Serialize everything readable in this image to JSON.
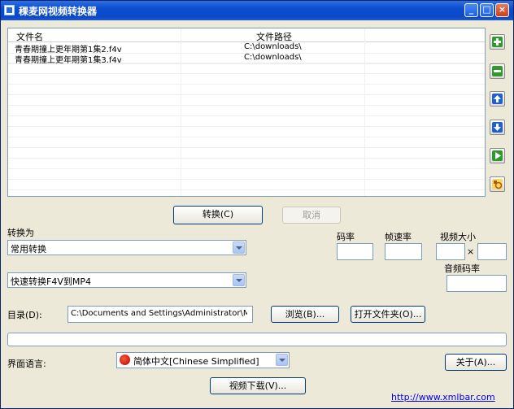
{
  "window": {
    "title": "稞麦网视频转换器"
  },
  "file_list": {
    "columns": [
      "文件名",
      "文件路径"
    ],
    "rows": [
      {
        "name": "青春期撞上更年期第1集2.f4v",
        "path": "C:\\downloads\\"
      },
      {
        "name": "青春期撞上更年期第1集3.f4v",
        "path": "C:\\downloads\\"
      }
    ]
  },
  "side_icons": [
    "add-icon",
    "remove-icon",
    "move-up-icon",
    "move-down-icon",
    "play-icon",
    "settings-icon"
  ],
  "actions": {
    "convert": "转换(C)",
    "cancel": "取消"
  },
  "convert_to": {
    "label": "转换为",
    "category": "常用转换",
    "preset": "快速转换F4V到MP4"
  },
  "params": {
    "bitrate_label": "码率",
    "framerate_label": "帧速率",
    "video_size_label": "视频大小",
    "size_sep": "×",
    "audio_bitrate_label": "音频码率"
  },
  "output": {
    "dir_label": "目录(D):",
    "dir_value": "C:\\Documents and Settings\\Administrator\\My Documents",
    "browse": "浏览(B)...",
    "open_folder": "打开文件夹(O)..."
  },
  "language": {
    "label": "界面语言:",
    "value": "简体中文[Chinese Simplified]"
  },
  "about": "关于(A)...",
  "video_download": "视频下载(V)...",
  "footer_link": "http://www.xmlbar.com",
  "colors": {
    "titlebar": "#0a4ed1",
    "window_bg": "#ece9d8"
  }
}
